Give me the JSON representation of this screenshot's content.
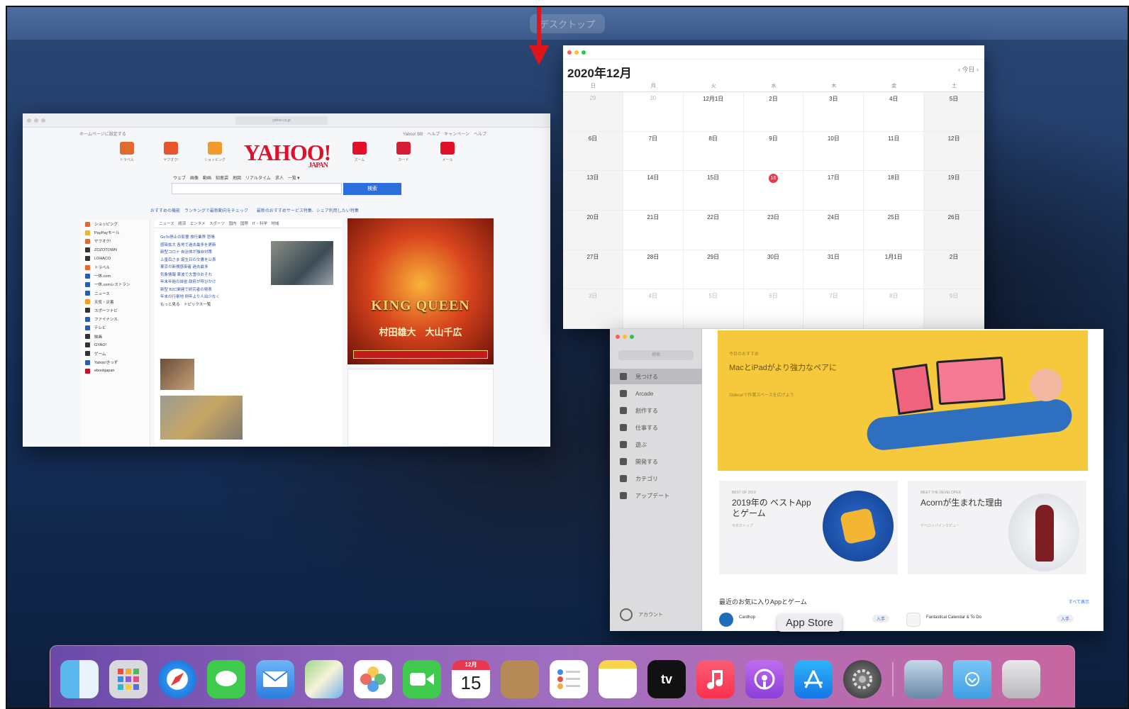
{
  "spaces": {
    "label": "デスクトップ"
  },
  "safari": {
    "url": "yahoo.co.jp",
    "yahoo": {
      "home_link": "ホームページに設定する",
      "top_links": "Yahoo! BB　ヘルプ　キャンペーン　ヘルプ",
      "logo": "YAHOO!",
      "logo_sub": "JAPAN",
      "services_left": [
        "トラベル",
        "ヤフオク!",
        "ショッピング"
      ],
      "services_right": [
        "ズーム",
        "カード",
        "メール"
      ],
      "search_tabs": "ウェブ　画像　動画　知恵袋　地図　リアルタイム　求人　一覧▼",
      "search_button": "検索",
      "notice": "おすすめの機能　ランキングで最新動向をチェック　　最新のおすすめサービス特集、シェア利用したい特集",
      "sidebar": [
        "ショッピング",
        "PayPayモール",
        "ヤフオク!",
        "ZOZOTOWN",
        "LOHACO",
        "トラベル",
        "一休.com",
        "一休.comレストラン",
        "ニュース",
        "天気・災害",
        "スポーツナビ",
        "ファイナンス",
        "テレビ",
        "映画",
        "GYAO!",
        "ゲーム",
        "Yahoo!きっず",
        "ebookjapan"
      ],
      "news_tabs": "ニュース　経済　エンタメ　スポーツ　国内　国際　IT・科学　地域",
      "news": [
        "GoTo停止の影響 旅行業界 悲鳴",
        "感染拡大 各地で過去最多を更新",
        "新型コロナ 自治体が独自対策",
        "上皇后さま 誕生日の文書を公表",
        "東京の新規感染者 過去最多",
        "気象情報 寒波で大雪のおそれ",
        "年末年始の帰省 政府が呼びかけ",
        "新型 B2C関連で研究者の発表",
        "年末の行楽地 例年より人出少なく"
      ],
      "news_more": "もっと見る　トピックス一覧",
      "ad_title": "KING QUEEN",
      "ad_names": "村田雄大　大山千広",
      "ad_strip": "レースアウト・公式投票情報をチェック"
    }
  },
  "calendar": {
    "title": "2020年12月",
    "nav": "‹  今日  ›",
    "dow": [
      "日",
      "月",
      "火",
      "水",
      "木",
      "金",
      "土"
    ],
    "weeks": [
      [
        "29",
        "30",
        "12月1日",
        "2日",
        "3日",
        "4日",
        "5日"
      ],
      [
        "6日",
        "7日",
        "8日",
        "9日",
        "10日",
        "11日",
        "12日"
      ],
      [
        "13日",
        "14日",
        "15日",
        "16日",
        "17日",
        "18日",
        "19日"
      ],
      [
        "20日",
        "21日",
        "22日",
        "23日",
        "24日",
        "25日",
        "26日"
      ],
      [
        "27日",
        "28日",
        "29日",
        "30日",
        "31日",
        "1月1日",
        "2日"
      ],
      [
        "3日",
        "4日",
        "5日",
        "6日",
        "7日",
        "8日",
        "9日"
      ]
    ]
  },
  "appstore": {
    "search_placeholder": "検索",
    "sidebar": [
      "見つける",
      "Arcade",
      "創作する",
      "仕事する",
      "遊ぶ",
      "開発する",
      "カテゴリ",
      "アップデート"
    ],
    "account": "アカウント",
    "hero": {
      "eyebrow": "今日のおすすめ",
      "title": "MacとiPadがより強力なペアに",
      "sub": "Sidecarで作業スペースを広げよう"
    },
    "card1": {
      "eyebrow": "BEST OF 2019",
      "title": "2019年の ベストAppとゲーム",
      "sub": "今年のトップ"
    },
    "card2": {
      "eyebrow": "MEET THE DEVELOPER",
      "title": "Acornが生まれた理由",
      "sub": "デベロッパインタビュー"
    },
    "fav_title": "最近のお気に入りAppとゲーム",
    "fav_more": "すべて表示",
    "apps": [
      {
        "name": "Cardhop",
        "button": "入手"
      },
      {
        "name": "Fantastical Calendar & To Do",
        "button": "入手"
      }
    ],
    "dock_label": "App Store"
  },
  "dock": {
    "calendar_month": "12月",
    "calendar_day": "15",
    "tv_label": "tv"
  }
}
